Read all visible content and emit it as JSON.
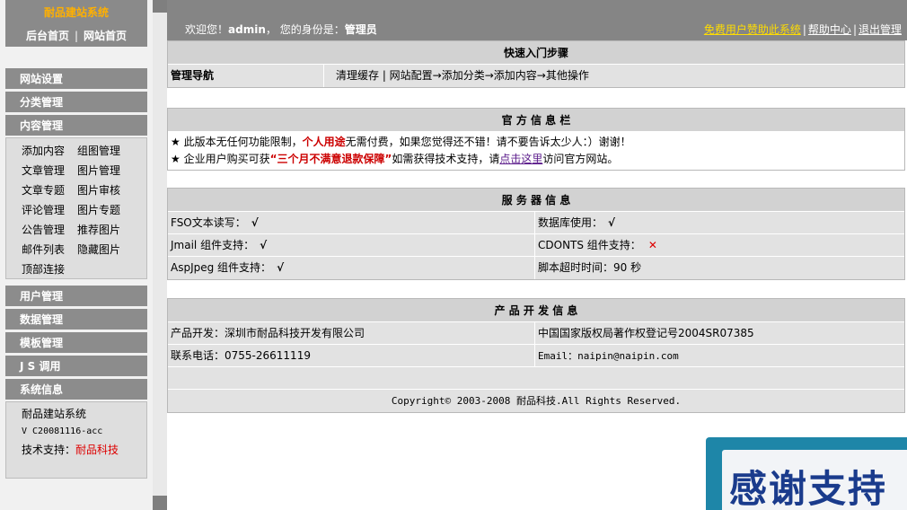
{
  "sidebar": {
    "logo": "耐品建站系统",
    "link_admin": "后台首页",
    "link_site": "网站首页",
    "link_sep": "|",
    "menus": {
      "site_settings": "网站设置",
      "category": "分类管理",
      "content": "内容管理",
      "users": "用户管理",
      "data": "数据管理",
      "template": "模板管理",
      "js": "J S 调用",
      "sysinfo": "系统信息"
    },
    "content_items": [
      "添加内容",
      "组图管理",
      "文章管理",
      "图片管理",
      "文章专题",
      "图片审核",
      "评论管理",
      "图片专题",
      "公告管理",
      "推荐图片",
      "邮件列表",
      "隐藏图片",
      "顶部连接"
    ],
    "sysinfo_items": {
      "name": "耐品建站系统",
      "version": "V C20081116-acc",
      "support_label": "技术支持：",
      "support_name": "耐品科技"
    }
  },
  "topbar": {
    "welcome_prefix": "欢迎您！",
    "username": "admin",
    "identity_prefix": "， 您的身份是：",
    "role": "管理员",
    "sponsor_link": "免费用户赞助此系统",
    "help_link": "帮助中心",
    "logout_link": "退出管理",
    "sep": "|"
  },
  "quickstart": {
    "title": "快速入门步骤",
    "label": "管理导航",
    "steps": "清理缓存 | 网站配置→添加分类→添加内容→其他操作"
  },
  "official": {
    "title": "官 方 信 息 栏",
    "line1_prefix": "★ 此版本无任何功能限制，",
    "line1_bold": "个人用途",
    "line1_suffix": "无需付费，如果您觉得还不错！请不要告诉太少人：）谢谢！",
    "line2_prefix": "★ 企业用户购买可获",
    "line2_bold": "“三个月不满意退款保障”",
    "line2_mid": "如需获得技术支持，请",
    "line2_link": "点击这里",
    "line2_suffix": "访问官方网站。"
  },
  "server": {
    "title": "服 务 器 信 息",
    "fso_label": "FSO文本读写：",
    "fso_value": "√",
    "db_label": "数据库使用：",
    "db_value": "√",
    "jmail_label": "Jmail 组件支持：",
    "jmail_value": "√",
    "cdonts_label": "CDONTS 组件支持：",
    "cdonts_value": "✕",
    "aspjpeg_label": "AspJpeg 组件支持：",
    "aspjpeg_value": "√",
    "timeout_label": "脚本超时时间：",
    "timeout_value": "90 秒"
  },
  "product": {
    "title": "产 品 开 发 信 息",
    "dev_label": "产品开发：",
    "dev_value": "深圳市耐品科技开发有限公司",
    "copyright_reg": "中国国家版权局著作权登记号2004SR07385",
    "phone_label": "联系电话：",
    "phone_value": "0755-26611119",
    "email_label": "Email：",
    "email_value": "naipin@naipin.com",
    "footer": "Copyright© 2003-2008 耐品科技.All Rights Reserved."
  },
  "badge": {
    "text": "感谢支持"
  },
  "colors": {
    "header_gray": "#858585",
    "menu_gray": "#8c8c8c",
    "panel_bg": "#dcdcdc",
    "logo_orange": "#ffb000",
    "sponsor_yellow": "#ffdd00",
    "badge_blue": "#1e86a8",
    "badge_text": "#1a3b8c",
    "warn_red": "#cc0000"
  }
}
